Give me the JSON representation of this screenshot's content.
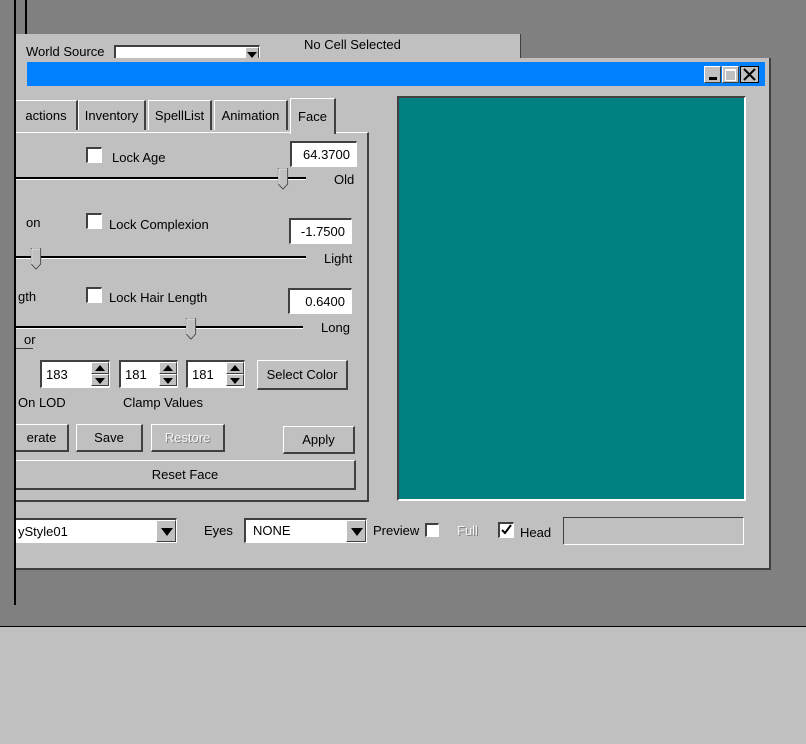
{
  "colors": {
    "desktop": "#808080",
    "titlebar": "#0080ff",
    "preview_bg": "#008080",
    "face": "#c0c0c0"
  },
  "bg_window": {
    "world_source_label": "World Source",
    "world_source_value": "",
    "status": "No Cell Selected"
  },
  "window": {
    "title": "",
    "controls": {
      "minimize": "minimize-icon",
      "maximize": "maximize-icon",
      "close": "close-icon"
    }
  },
  "tabs": [
    "actions",
    "Inventory",
    "SpellList",
    "Animation",
    "Face"
  ],
  "active_tab": "Face",
  "face": {
    "age": {
      "lock_label": "Lock Age",
      "value": "64.3700",
      "end_label": "Old",
      "level": 0.88
    },
    "complexion": {
      "partial_label": "on",
      "lock_label": "Lock Complexion",
      "value": "-1.7500",
      "end_label": "Light",
      "level": 0.03
    },
    "hair_length": {
      "partial_label": "gth",
      "lock_label": "Lock Hair Length",
      "value": "0.6400",
      "end_label": "Long",
      "level": 0.62
    },
    "hair_color_partial": "or",
    "color": {
      "r": "183",
      "g": "181",
      "b": "181",
      "select_label": "Select Color",
      "clamp_label": "Clamp Values",
      "lod_partial": "On LOD"
    },
    "buttons": {
      "generate": "erate",
      "save": "Save",
      "restore": "Restore",
      "apply": "Apply",
      "reset": "Reset Face"
    }
  },
  "bottom": {
    "hair_style_value": "yStyle01",
    "eyes_label": "Eyes",
    "eyes_value": "NONE",
    "preview_label": "Preview",
    "full_label": "Full",
    "head_label": "Head",
    "head_checked": true,
    "text_field": ""
  }
}
